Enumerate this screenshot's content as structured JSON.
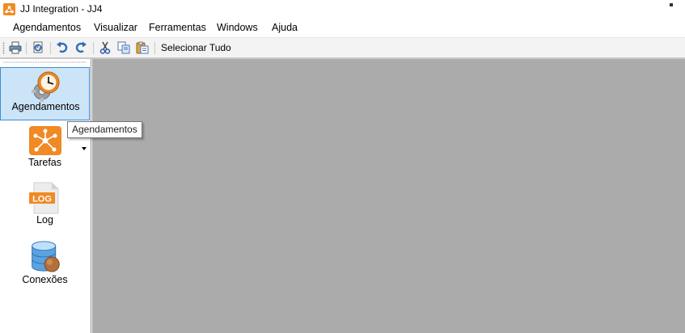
{
  "window": {
    "title": "JJ Integration - JJ4",
    "icon": "jj-logo-icon"
  },
  "menu": {
    "items": [
      "Agendamentos",
      "Visualizar",
      "Ferramentas",
      "Windows",
      "Ajuda"
    ]
  },
  "toolbar": {
    "buttons": [
      "print-icon",
      "print-preview-icon",
      "undo-icon",
      "redo-icon",
      "cut-icon",
      "copy-icon",
      "paste-icon"
    ],
    "select_all_label": "Selecionar Tudo"
  },
  "sidebar": {
    "items": [
      {
        "label": "Agendamentos",
        "icon": "clock-gear-icon",
        "selected": true
      },
      {
        "label": "Tarefas",
        "icon": "network-icon",
        "selected": false
      },
      {
        "label": "Log",
        "icon": "log-file-icon",
        "selected": false
      },
      {
        "label": "Conexões",
        "icon": "database-icon",
        "selected": false
      }
    ]
  },
  "tooltip": {
    "text": "Agendamentos"
  },
  "colors": {
    "selected_bg": "#cce4f7",
    "selected_border": "#3d8ed3",
    "mdi_background": "#ababab",
    "accent_orange": "#f08a24"
  }
}
